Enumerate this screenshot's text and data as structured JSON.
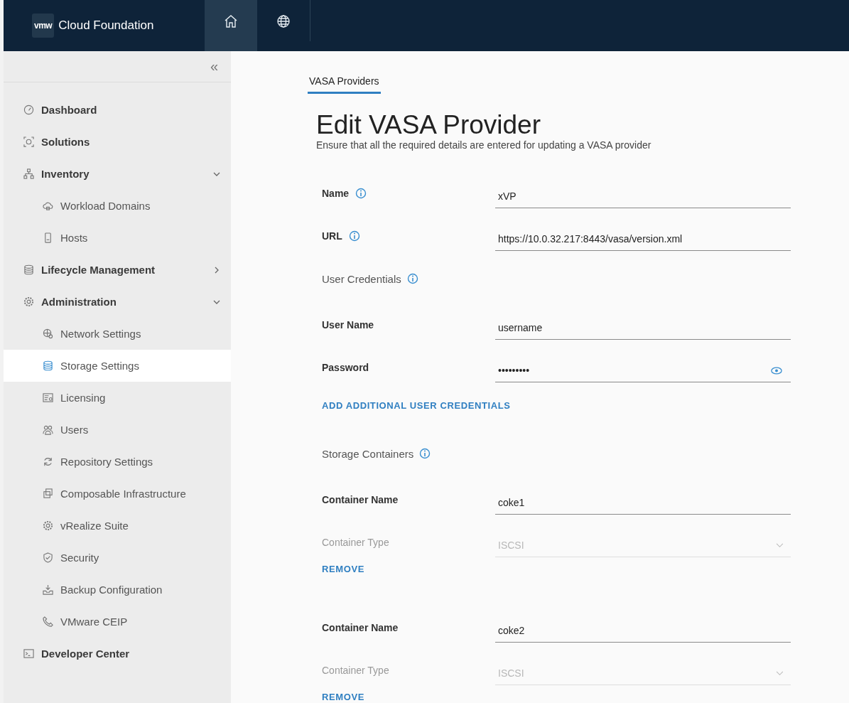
{
  "header": {
    "brand_mark": "vmw",
    "product": "Cloud Foundation",
    "nav": [
      {
        "selected": true
      },
      {
        "selected": false
      }
    ]
  },
  "sidebar": {
    "collapse": "«",
    "items": [
      {
        "label": "Dashboard",
        "selected": false
      },
      {
        "label": "Solutions",
        "selected": false
      },
      {
        "label": "Inventory",
        "selected": false,
        "expanded": true,
        "children": [
          {
            "label": "Workload Domains",
            "selected": false
          },
          {
            "label": "Hosts",
            "selected": false
          }
        ]
      },
      {
        "label": "Lifecycle Management",
        "selected": false,
        "expanded": false
      },
      {
        "label": "Administration",
        "selected": false,
        "expanded": true,
        "children": [
          {
            "label": "Network Settings",
            "selected": false
          },
          {
            "label": "Storage Settings",
            "selected": true
          },
          {
            "label": "Licensing",
            "selected": false
          },
          {
            "label": "Users",
            "selected": false
          },
          {
            "label": "Repository Settings",
            "selected": false
          },
          {
            "label": "Composable Infrastructure",
            "selected": false
          },
          {
            "label": "vRealize Suite",
            "selected": false
          },
          {
            "label": "Security",
            "selected": false
          },
          {
            "label": "Backup Configuration",
            "selected": false
          },
          {
            "label": "VMware CEIP",
            "selected": false
          }
        ]
      },
      {
        "label": "Developer Center",
        "selected": false
      }
    ]
  },
  "tabs": [
    {
      "label": "VASA Providers",
      "selected": true
    }
  ],
  "title": "Edit VASA Provider",
  "subtitle": "Ensure that all the required details are entered for updating a VASA provider",
  "fields": [
    {
      "label": "Name",
      "info": true,
      "kind": "text",
      "value": "xVP",
      "disabled": false
    },
    {
      "label": "URL",
      "info": true,
      "kind": "text",
      "value": "https://10.0.32.217:8443/vasa/version.xml",
      "disabled": false
    }
  ],
  "credentials": {
    "heading": "User Credentials",
    "info": true,
    "fields": [
      {
        "label": "User Name",
        "kind": "text",
        "value": "username",
        "disabled": false
      },
      {
        "label": "Password",
        "kind": "password",
        "value": "•••••••••",
        "disabled": false
      }
    ],
    "add_link": "ADD ADDITIONAL USER CREDENTIALS"
  },
  "containers": {
    "heading": "Storage Containers",
    "info": true,
    "items": [
      {
        "fields": [
          {
            "label": "Container Name",
            "kind": "text",
            "value": "coke1",
            "disabled": false
          },
          {
            "label": "Container Type",
            "kind": "select",
            "value": "ISCSI",
            "disabled": true
          }
        ],
        "remove": "REMOVE"
      },
      {
        "fields": [
          {
            "label": "Container Name",
            "kind": "text",
            "value": "coke2",
            "disabled": false
          },
          {
            "label": "Container Type",
            "kind": "select",
            "value": "ISCSI",
            "disabled": true
          }
        ],
        "remove": "REMOVE"
      }
    ]
  }
}
